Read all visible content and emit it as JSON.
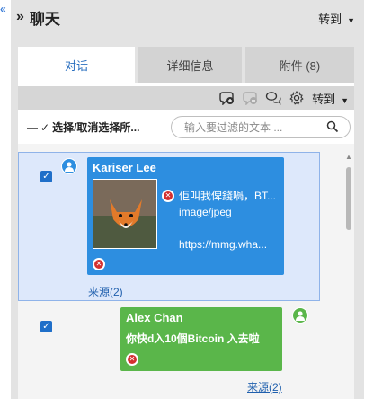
{
  "panel": {
    "collapse_icon": "chevron-left-double",
    "expand_icon": "chevron-right-double",
    "title": "聊天",
    "goto_label": "转到"
  },
  "tabs": [
    {
      "label": "对话",
      "active": true
    },
    {
      "label": "详细信息",
      "active": false
    },
    {
      "label": "附件 (8)",
      "active": false
    }
  ],
  "toolbar": {
    "icons": [
      "add-tag-icon",
      "remove-tag-icon",
      "chat-bubbles-icon",
      "settings-icon"
    ],
    "goto_label": "转到"
  },
  "filter": {
    "select_all_label": "选择/取消选择所...",
    "placeholder": "输入要过滤的文本 ..."
  },
  "messages": [
    {
      "sender": "Kariser Lee",
      "checked": true,
      "attachment_lines": [
        "佢叫我俾錢喎，BT...",
        "image/jpeg",
        "",
        "https://mmg.wha..."
      ],
      "source_link": "来源(2)",
      "color": "#2d8ee0"
    },
    {
      "sender": "Alex Chan",
      "checked": true,
      "text": "你快d入10個Bitcoin 入去啦",
      "source_link": "来源(2)",
      "color": "#5ab64a"
    }
  ]
}
